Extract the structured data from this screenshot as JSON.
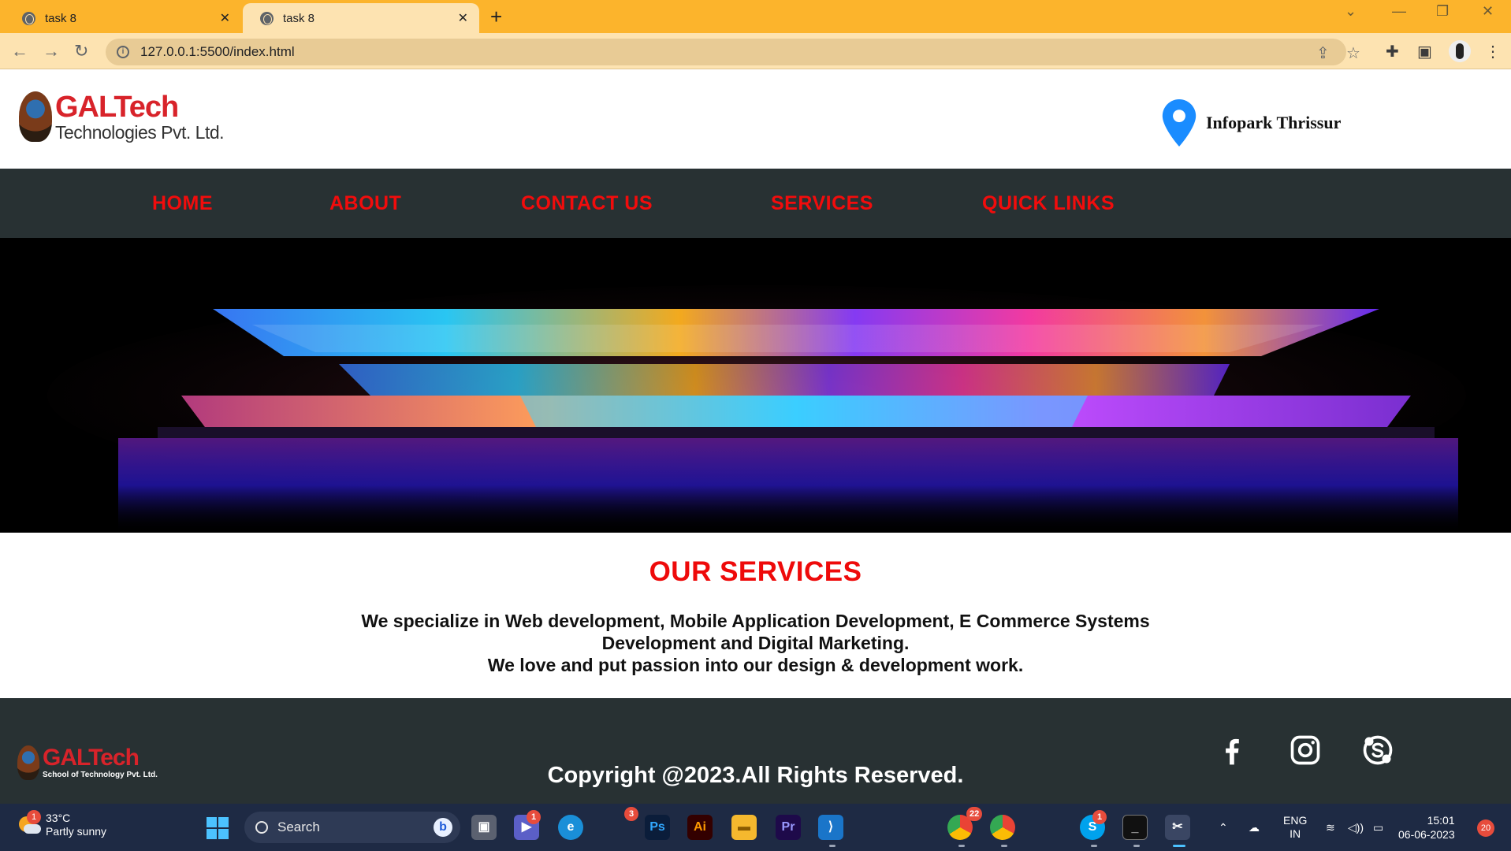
{
  "browser": {
    "tabs": [
      {
        "title": "task 8",
        "active": false
      },
      {
        "title": "task 8",
        "active": true
      }
    ],
    "url": "127.0.0.1:5500/index.html"
  },
  "header": {
    "logo_main": "GALTech",
    "logo_sub": "Technologies Pvt. Ltd.",
    "location": "Infopark Thrissur"
  },
  "nav": {
    "items": [
      "HOME",
      "ABOUT",
      "CONTACT US",
      "SERVICES",
      "QUICK LINKS"
    ],
    "color": "#f20c0c",
    "background": "#283133"
  },
  "services": {
    "title": "OUR SERVICES",
    "line1": "We specialize in Web development, Mobile Application Development, E Commerce Systems Development and Digital Marketing.",
    "line2": "We love and put passion into our design & development work."
  },
  "footer": {
    "logo_main": "GALTech",
    "logo_sub": "School of Technology Pvt. Ltd.",
    "copyright": "Copyright @2023.All Rights Reserved.",
    "social": [
      "facebook-icon",
      "instagram-icon",
      "skype-icon"
    ]
  },
  "taskbar": {
    "weather_temp": "33°C",
    "weather_desc": "Partly sunny",
    "weather_badge": "1",
    "search_placeholder": "Search",
    "teams_badge": "1",
    "photoshop_badge": "3",
    "photoshop_label": "Ps",
    "illustrator_label": "Ai",
    "premiere_label": "Pr",
    "chrome_badge": "22",
    "skype_badge": "1",
    "skype_label": "S",
    "lang_1": "ENG",
    "lang_2": "IN",
    "time": "15:01",
    "date": "06-06-2023",
    "notifications": "20"
  }
}
